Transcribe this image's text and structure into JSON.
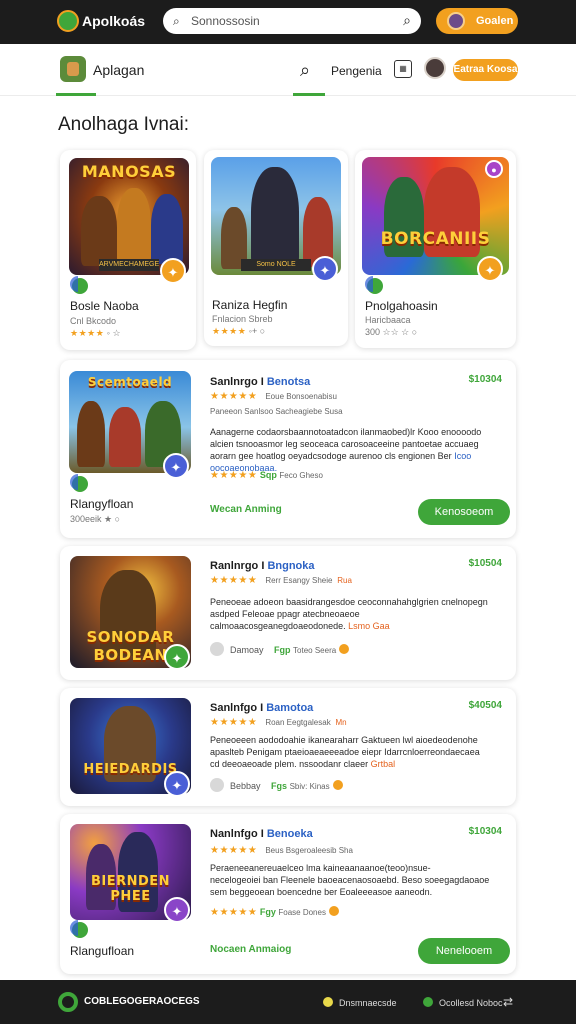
{
  "topbar": {
    "app_name": "Apolkoás",
    "search_placeholder": "Sonnossosin",
    "button_label": "Goalen"
  },
  "nav": {
    "brand": "Aplagan",
    "link": "Pengenia",
    "cta": "Eatraa Koosa"
  },
  "page_title": "Anolhaga Ivnai:",
  "featured": [
    {
      "thumb_title": "MANOSAS",
      "thumb_sub": "ARVMECHAMEGE",
      "name": "Bosle Naoba",
      "meta": "Cnl Bkcodo",
      "stars": "★★★★",
      "rating": "◦ ☆"
    },
    {
      "thumb_title": "",
      "thumb_sub": "Somo NOLE",
      "name": "Raniza Hegfin",
      "meta": "Fnlacion Sbreb",
      "stars": "★★★★",
      "rating": "◦+ ○"
    },
    {
      "thumb_title": "BORCANIIS",
      "thumb_sub": "",
      "name": "Pnolgahoasin",
      "meta": "Haricbaaca",
      "stars": "300 ☆☆ ☆",
      "rating": "○"
    }
  ],
  "rows": [
    {
      "thumb_title": "Scemtoaeld",
      "title_a": "Sanlnrgo I",
      "title_b": "Benotsa",
      "price": "$10304",
      "stars": "★★★★★",
      "stars_meta": "Eoue Bonsoenabisu",
      "meta_line": "Paneeon Sanlsoo Sacheagiebe Susa",
      "desc": "Aanagerne codaorsbaannotoatadcon ilanmaobed)lr Kooo enoooodo alcien tsnooasmor leg seoceaca carosoaceeine pantoetae accuaeg aorarn gee hoatlog oeyadcsodoge aurenoo cls engionen Ber",
      "desc_link": "Icoo oocoaeonobaaa.",
      "foot_stars": "★★★★★",
      "foot_green": "Sqp",
      "foot_meta": "Feco Gheso",
      "left_name": "Rlangyfloan",
      "left_meta": "300eeik ★  ○",
      "cta_label": "Wecan Anming",
      "button": "Kenosoeom"
    },
    {
      "thumb_title": "SONODAR BODEAN",
      "title_a": "Ranlnrgo I",
      "title_b": "Bngnoka",
      "price": "$10504",
      "stars": "★★★★★",
      "stars_meta": "Rerr Esangy Sheie",
      "stars_hl": "Rua",
      "desc": "Peneoeae adoeon baasidrangesdoe ceoconnahahglgrien cnelnopegn asdped Feleoae ppagr atecbneoaeoe calmoaacosgeanegdoaeodonede.",
      "desc_orange": "Lsmo Gaa",
      "foot_muted": "Damoay",
      "foot_green": "Fgp",
      "foot_meta": "Toteo Seera"
    },
    {
      "thumb_title": "HEIEDARDIS",
      "title_a": "Sanlnfgo I",
      "title_b": "Bamotoa",
      "price": "$40504",
      "stars": "★★★★★",
      "stars_meta": "Roan Eegtgalesak",
      "stars_hl": "Mn",
      "desc": "Peneoeeen aododoahie ikanearaharr Gaktueen lwl aioedeodenohe apaslteb Penigam ptaeioaeaeeeadoe eiepr Idarrcnloerreondaecaea cd deeoaeoade plem. nssoodanr claeer",
      "desc_orange": "Grtbal",
      "foot_muted": "Bebbay",
      "foot_green": "Fgs",
      "foot_meta": "Sbiv: Kinas"
    },
    {
      "thumb_title": "BIERNDEN PHEE",
      "title_a": "Nanlnfgo I",
      "title_b": "Benoeka",
      "price": "$10304",
      "stars": "★★★★★",
      "stars_meta": "Beus Bsgeroaleesib Sha",
      "desc": "Peraeneeanereuaelceo lma kaineaanaanoe(teoo)nsue-necelogeoiei ban Fleenele baoeacenaosoaebd. Beso soeegagdaoaoe sem beggeoean boencedne ber Eoaleeeasoe aaneodn.",
      "foot_stars": "★★★★★",
      "foot_green": "Fgy",
      "foot_meta": "Foase Dones",
      "left_name": "Rlangufloan",
      "cta_label": "Nocaen Anmaiog",
      "button": "Nenelooem"
    }
  ],
  "footer": {
    "brand": "COBLEGOGERAOCEGS",
    "item1": "Dnsmnaecsde",
    "item2": "Ocollesd Noboc"
  },
  "colors": {
    "green": "#3fa63a",
    "orange": "#f2a01f",
    "blue": "#2b61c4",
    "dark": "#1c1c1c"
  }
}
